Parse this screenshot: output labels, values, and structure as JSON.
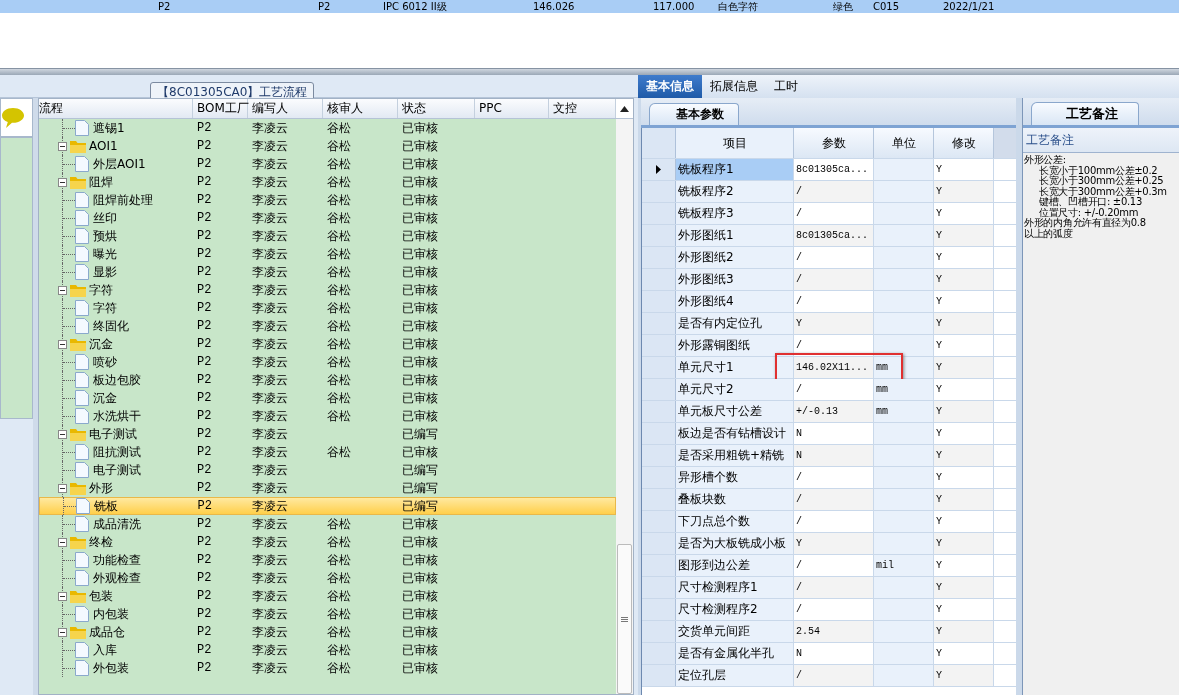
{
  "top_row": {
    "cells": [
      "P2",
      "P2",
      "IPC 6012 II级",
      "146.026",
      "117.000",
      "白色字符",
      "绿色",
      "C015",
      "2022/1/21"
    ]
  },
  "process_panel": {
    "title": "【8C01305CA0】工艺流程",
    "columns": [
      "流程",
      "BOM工厂",
      "编写人",
      "核审人",
      "状态",
      "PPC",
      "文控"
    ],
    "rows": [
      {
        "kind": "leaf",
        "name": "遮锡1",
        "bom": "P2",
        "writer": "李凌云",
        "reviewer": "谷松",
        "status": "已审核",
        "selected": false
      },
      {
        "kind": "group",
        "name": "AOI1",
        "bom": "P2",
        "writer": "李凌云",
        "reviewer": "谷松",
        "status": "已审核",
        "selected": false,
        "children": [
          {
            "kind": "leaf",
            "name": "外层AOI1",
            "bom": "P2",
            "writer": "李凌云",
            "reviewer": "谷松",
            "status": "已审核",
            "selected": false
          }
        ]
      },
      {
        "kind": "group",
        "name": "阻焊",
        "bom": "P2",
        "writer": "李凌云",
        "reviewer": "谷松",
        "status": "已审核",
        "selected": false,
        "children": [
          {
            "kind": "leaf",
            "name": "阻焊前处理",
            "bom": "P2",
            "writer": "李凌云",
            "reviewer": "谷松",
            "status": "已审核",
            "selected": false
          },
          {
            "kind": "leaf",
            "name": "丝印",
            "bom": "P2",
            "writer": "李凌云",
            "reviewer": "谷松",
            "status": "已审核",
            "selected": false
          },
          {
            "kind": "leaf",
            "name": "预烘",
            "bom": "P2",
            "writer": "李凌云",
            "reviewer": "谷松",
            "status": "已审核",
            "selected": false
          },
          {
            "kind": "leaf",
            "name": "曝光",
            "bom": "P2",
            "writer": "李凌云",
            "reviewer": "谷松",
            "status": "已审核",
            "selected": false
          },
          {
            "kind": "leaf",
            "name": "显影",
            "bom": "P2",
            "writer": "李凌云",
            "reviewer": "谷松",
            "status": "已审核",
            "selected": false
          }
        ]
      },
      {
        "kind": "group",
        "name": "字符",
        "bom": "P2",
        "writer": "李凌云",
        "reviewer": "谷松",
        "status": "已审核",
        "selected": false,
        "children": [
          {
            "kind": "leaf",
            "name": "字符",
            "bom": "P2",
            "writer": "李凌云",
            "reviewer": "谷松",
            "status": "已审核",
            "selected": false
          },
          {
            "kind": "leaf",
            "name": "终固化",
            "bom": "P2",
            "writer": "李凌云",
            "reviewer": "谷松",
            "status": "已审核",
            "selected": false
          }
        ]
      },
      {
        "kind": "group",
        "name": "沉金",
        "bom": "P2",
        "writer": "李凌云",
        "reviewer": "谷松",
        "status": "已审核",
        "selected": false,
        "children": [
          {
            "kind": "leaf",
            "name": "喷砂",
            "bom": "P2",
            "writer": "李凌云",
            "reviewer": "谷松",
            "status": "已审核",
            "selected": false
          },
          {
            "kind": "leaf",
            "name": "板边包胶",
            "bom": "P2",
            "writer": "李凌云",
            "reviewer": "谷松",
            "status": "已审核",
            "selected": false
          },
          {
            "kind": "leaf",
            "name": "沉金",
            "bom": "P2",
            "writer": "李凌云",
            "reviewer": "谷松",
            "status": "已审核",
            "selected": false
          },
          {
            "kind": "leaf",
            "name": "水洗烘干",
            "bom": "P2",
            "writer": "李凌云",
            "reviewer": "谷松",
            "status": "已审核",
            "selected": false
          }
        ]
      },
      {
        "kind": "group",
        "name": "电子测试",
        "bom": "P2",
        "writer": "李凌云",
        "status": "已编写",
        "selected": false,
        "children": [
          {
            "kind": "leaf",
            "name": "阻抗测试",
            "bom": "P2",
            "writer": "李凌云",
            "reviewer": "谷松",
            "status": "已审核",
            "selected": false
          },
          {
            "kind": "leaf",
            "name": "电子测试",
            "bom": "P2",
            "writer": "李凌云",
            "status": "已编写",
            "selected": false
          }
        ]
      },
      {
        "kind": "group",
        "name": "外形",
        "bom": "P2",
        "writer": "李凌云",
        "status": "已编写",
        "selected": false,
        "children": [
          {
            "kind": "leaf",
            "name": "铣板",
            "bom": "P2",
            "writer": "李凌云",
            "status": "已编写",
            "selected": true
          },
          {
            "kind": "leaf",
            "name": "成品清洗",
            "bom": "P2",
            "writer": "李凌云",
            "reviewer": "谷松",
            "status": "已审核",
            "selected": false
          }
        ]
      },
      {
        "kind": "group",
        "name": "终检",
        "bom": "P2",
        "writer": "李凌云",
        "reviewer": "谷松",
        "status": "已审核",
        "selected": false,
        "children": [
          {
            "kind": "leaf",
            "name": "功能检查",
            "bom": "P2",
            "writer": "李凌云",
            "reviewer": "谷松",
            "status": "已审核",
            "selected": false
          },
          {
            "kind": "leaf",
            "name": "外观检查",
            "bom": "P2",
            "writer": "李凌云",
            "reviewer": "谷松",
            "status": "已审核",
            "selected": false
          }
        ]
      },
      {
        "kind": "group",
        "name": "包装",
        "bom": "P2",
        "writer": "李凌云",
        "reviewer": "谷松",
        "status": "已审核",
        "selected": false,
        "children": [
          {
            "kind": "leaf",
            "name": "内包装",
            "bom": "P2",
            "writer": "李凌云",
            "reviewer": "谷松",
            "status": "已审核",
            "selected": false
          }
        ]
      },
      {
        "kind": "group",
        "name": "成品仓",
        "bom": "P2",
        "writer": "李凌云",
        "reviewer": "谷松",
        "status": "已审核",
        "selected": false,
        "children": [
          {
            "kind": "leaf",
            "name": "入库",
            "bom": "P2",
            "writer": "李凌云",
            "reviewer": "谷松",
            "status": "已审核",
            "selected": false
          },
          {
            "kind": "leaf",
            "name": "外包装",
            "bom": "P2",
            "writer": "李凌云",
            "reviewer": "谷松",
            "status": "已审核",
            "selected": false
          }
        ]
      }
    ]
  },
  "tabs": [
    {
      "label": "基本信息",
      "selected": true
    },
    {
      "label": "拓展信息",
      "selected": false
    },
    {
      "label": "工时",
      "selected": false
    }
  ],
  "params": {
    "tab": "基本参数",
    "columns": [
      "项目",
      "参数",
      "单位",
      "修改"
    ],
    "rows": [
      {
        "item": "铣板程序1",
        "value": "8c01305ca...",
        "modify": "Y",
        "current": true,
        "highlighted": false
      },
      {
        "item": "铣板程序2",
        "value": "/",
        "modify": "Y",
        "current": false,
        "highlighted": false
      },
      {
        "item": "铣板程序3",
        "value": "/",
        "modify": "Y",
        "current": false,
        "highlighted": false
      },
      {
        "item": "外形图纸1",
        "value": "8c01305ca...",
        "modify": "Y",
        "current": false,
        "highlighted": false
      },
      {
        "item": "外形图纸2",
        "value": "/",
        "modify": "Y",
        "current": false,
        "highlighted": false
      },
      {
        "item": "外形图纸3",
        "value": "/",
        "modify": "Y",
        "current": false,
        "highlighted": false
      },
      {
        "item": "外形图纸4",
        "value": "/",
        "modify": "Y",
        "current": false,
        "highlighted": false
      },
      {
        "item": "是否有内定位孔",
        "value": "Y",
        "modify": "Y",
        "current": false,
        "highlighted": false
      },
      {
        "item": "外形露铜图纸",
        "value": "/",
        "modify": "Y",
        "current": false,
        "highlighted": false
      },
      {
        "item": "单元尺寸1",
        "value": "146.02X11...",
        "unit": "mm",
        "modify": "Y",
        "current": false,
        "highlighted": true
      },
      {
        "item": "单元尺寸2",
        "value": "/",
        "unit": "mm",
        "modify": "Y",
        "current": false,
        "highlighted": false
      },
      {
        "item": "单元板尺寸公差",
        "value": "+/-0.13",
        "unit": "mm",
        "modify": "Y",
        "current": false,
        "highlighted": false
      },
      {
        "item": "板边是否有钻槽设计",
        "value": "N",
        "modify": "Y",
        "current": false,
        "highlighted": false
      },
      {
        "item": "是否采用粗铣+精铣",
        "value": "N",
        "modify": "Y",
        "current": false,
        "highlighted": false
      },
      {
        "item": "异形槽个数",
        "value": "/",
        "modify": "Y",
        "current": false,
        "highlighted": false
      },
      {
        "item": "叠板块数",
        "value": "/",
        "modify": "Y",
        "current": false,
        "highlighted": false
      },
      {
        "item": "下刀点总个数",
        "value": "/",
        "modify": "Y",
        "current": false,
        "highlighted": false
      },
      {
        "item": "是否为大板铣成小板",
        "value": "Y",
        "modify": "Y",
        "current": false,
        "highlighted": false
      },
      {
        "item": "图形到边公差",
        "value": "/",
        "unit": "mil",
        "modify": "Y",
        "current": false,
        "highlighted": false
      },
      {
        "item": "尺寸检测程序1",
        "value": "/",
        "modify": "Y",
        "current": false,
        "highlighted": false
      },
      {
        "item": "尺寸检测程序2",
        "value": "/",
        "modify": "Y",
        "current": false,
        "highlighted": false
      },
      {
        "item": "交货单元间距",
        "value": "2.54",
        "modify": "Y",
        "current": false,
        "highlighted": false
      },
      {
        "item": "是否有金属化半孔",
        "value": "N",
        "modify": "Y",
        "current": false,
        "highlighted": false
      },
      {
        "item": "定位孔层",
        "value": "/",
        "modify": "Y",
        "current": false,
        "highlighted": false
      }
    ]
  },
  "notes": {
    "tab": "工艺备注",
    "label": "工艺备注",
    "lines": [
      {
        "text": "外形公差:",
        "indented": false
      },
      {
        "text": "长宽小于100mm公差±0.2",
        "indented": true
      },
      {
        "text": "长宽小于300mm公差+0.25",
        "indented": true
      },
      {
        "text": "长宽大于300mm公差+0.3m",
        "indented": true
      },
      {
        "text": "键槽、凹槽开口: ±0.13",
        "indented": true
      },
      {
        "text": "位置尺寸: +/-0.20mm",
        "indented": true
      },
      {
        "text": "外形的内角允许有直径为0.8",
        "indented": false
      },
      {
        "text": "以上的弧度",
        "indented": false
      }
    ]
  }
}
